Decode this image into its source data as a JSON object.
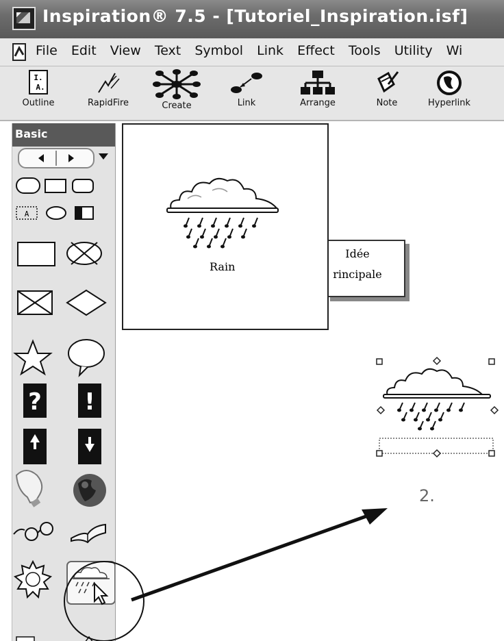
{
  "window": {
    "title": "Inspiration® 7.5 - [Tutoriel_Inspiration.isf]"
  },
  "menu": {
    "items": [
      "File",
      "Edit",
      "View",
      "Text",
      "Symbol",
      "Link",
      "Effect",
      "Tools",
      "Utility",
      "Wi"
    ]
  },
  "toolbar": {
    "outline": "Outline",
    "rapidfire": "RapidFire",
    "create": "Create",
    "link": "Link",
    "arrange": "Arrange",
    "note": "Note",
    "hyperlink": "Hyperlink"
  },
  "palette": {
    "title": "Basic"
  },
  "canvas": {
    "rain_label": "Rain",
    "idea_line1": "Idée",
    "idea_line2": "rincipale",
    "step": "2."
  }
}
